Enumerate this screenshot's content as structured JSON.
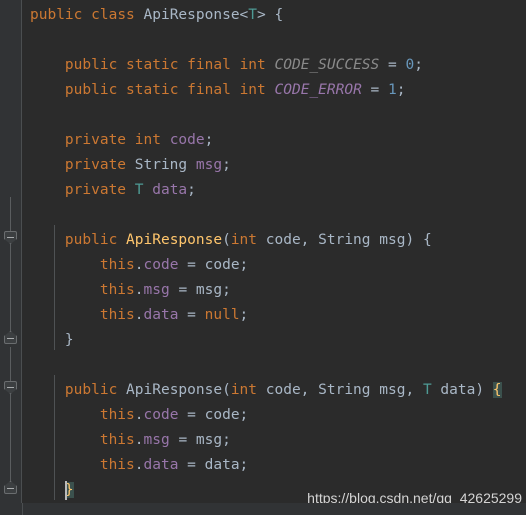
{
  "editor": {
    "language": "java",
    "theme": "darcula",
    "background_color": "#2b2b2b",
    "gutter_color": "#313335",
    "caret_color": "#bbbbbb",
    "brace_match_highlight_color": "#3b514d"
  },
  "code": {
    "lines": [
      "public class ApiResponse<T> {",
      "",
      "    public static final int CODE_SUCCESS = 0;",
      "    public static final int CODE_ERROR = 1;",
      "",
      "    private int code;",
      "    private String msg;",
      "    private T data;",
      "",
      "    public ApiResponse(int code, String msg) {",
      "        this.code = code;",
      "        this.msg = msg;",
      "        this.data = null;",
      "    }",
      "",
      "    public ApiResponse(int code, String msg, T data) {",
      "        this.code = code;",
      "        this.msg = msg;",
      "        this.data = data;",
      "    }"
    ],
    "class_name": "ApiResponse",
    "type_parameter": "T",
    "constants": [
      {
        "name": "CODE_SUCCESS",
        "type": "int",
        "value": "0"
      },
      {
        "name": "CODE_ERROR",
        "type": "int",
        "value": "1"
      }
    ],
    "fields": [
      {
        "name": "code",
        "type": "int",
        "modifier": "private"
      },
      {
        "name": "msg",
        "type": "String",
        "modifier": "private"
      },
      {
        "name": "data",
        "type": "T",
        "modifier": "private"
      }
    ],
    "constructors": [
      {
        "params": "int code, String msg",
        "assigns": [
          "this.code = code;",
          "this.msg = msg;",
          "this.data = null;"
        ]
      },
      {
        "params": "int code, String msg, T data",
        "assigns": [
          "this.code = code;",
          "this.msg = msg;",
          "this.data = data;"
        ]
      }
    ],
    "tokens": {
      "public": "public",
      "class": "class",
      "static": "static",
      "final": "final",
      "private": "private",
      "int": "int",
      "string": "String",
      "this": "this",
      "null": "null",
      "lt": "<",
      "gt": ">",
      "lbrace": "{",
      "rbrace": "}",
      "lparen": "(",
      "rparen": ")",
      "semicolon": ";",
      "comma": ",",
      "dot": ".",
      "assign": "=",
      "space": " ",
      "t": "T",
      "code": "code",
      "msg": "msg",
      "data": "data",
      "code_success": "CODE_SUCCESS",
      "code_error": "CODE_ERROR",
      "api_response": "ApiResponse",
      "zero": "0",
      "one": "1"
    }
  },
  "gutter": {
    "fold_markers": [
      {
        "type": "collapse-down",
        "line": 10
      },
      {
        "type": "collapse-up",
        "line": 14
      },
      {
        "type": "collapse-down",
        "line": 16
      },
      {
        "type": "collapse-up",
        "line": 20
      }
    ]
  },
  "watermark": {
    "text": "https://blog.csdn.net/qq_42625299"
  }
}
